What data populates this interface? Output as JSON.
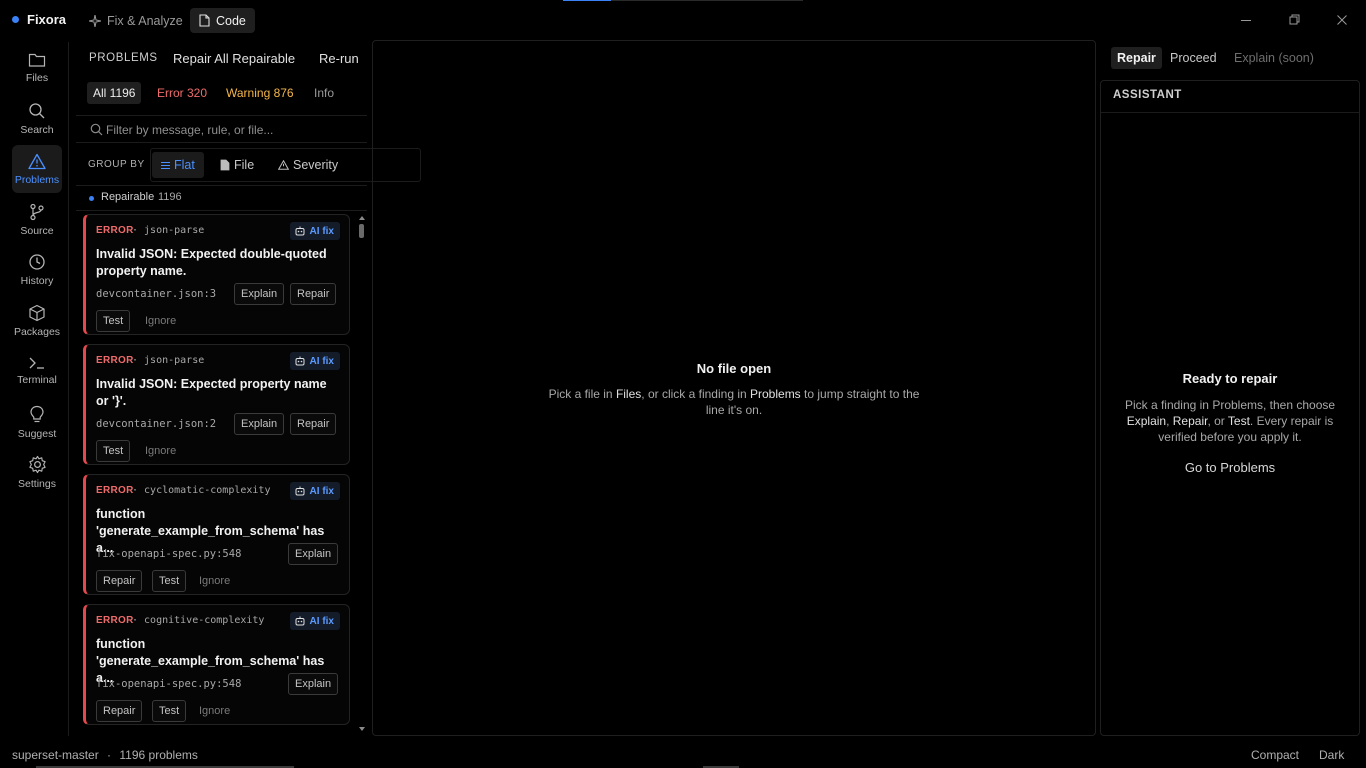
{
  "app": {
    "name": "Fixora"
  },
  "top_tabs": [
    {
      "label": "Fix & Analyze",
      "icon": "sparkle-icon"
    },
    {
      "label": "Code",
      "icon": "file-icon"
    }
  ],
  "top_progress": {
    "fraction": 0.2
  },
  "rail": [
    {
      "label": "Files",
      "icon": "folder-icon"
    },
    {
      "label": "Search",
      "icon": "search-icon"
    },
    {
      "label": "Problems",
      "icon": "warning-triangle-icon",
      "active": true
    },
    {
      "label": "Source",
      "icon": "git-branch-icon"
    },
    {
      "label": "History",
      "icon": "clock-icon"
    },
    {
      "label": "Packages",
      "icon": "package-icon"
    },
    {
      "label": "Terminal",
      "icon": "terminal-icon"
    },
    {
      "label": "Suggest",
      "icon": "lightbulb-icon"
    },
    {
      "label": "Settings",
      "icon": "gear-icon"
    }
  ],
  "problems": {
    "title": "PROBLEMS",
    "repair_all": "Repair All Repairable",
    "rerun": "Re-run",
    "filters": {
      "all": "All 1196",
      "error": "Error 320",
      "warning": "Warning 876",
      "info": "Info"
    },
    "search_placeholder": "Filter by message, rule, or file...",
    "group_by": {
      "label": "GROUP BY",
      "flat": "Flat",
      "file": "File",
      "severity": "Severity"
    },
    "repairable": {
      "label": "Repairable",
      "count": "1196"
    },
    "cards": [
      {
        "severity": "ERROR",
        "rule": "· json-parse",
        "badge": "AI fix",
        "title": "Invalid JSON: Expected double-quoted property name.",
        "file": "devcontainer.json:3",
        "explain": "Explain",
        "repair": "Repair",
        "test": "Test",
        "ignore": "Ignore"
      },
      {
        "severity": "ERROR",
        "rule": "· json-parse",
        "badge": "AI fix",
        "title": "Invalid JSON: Expected property name or '}'.",
        "file": "devcontainer.json:2",
        "explain": "Explain",
        "repair": "Repair",
        "test": "Test",
        "ignore": "Ignore"
      },
      {
        "severity": "ERROR",
        "rule": "· cyclomatic-complexity",
        "badge": "AI fix",
        "title_line1": "function",
        "title_line2": "'generate_example_from_schema' has a...",
        "file": "fix-openapi-spec.py:548",
        "explain": "Explain",
        "repair": "Repair",
        "test": "Test",
        "ignore": "Ignore"
      },
      {
        "severity": "ERROR",
        "rule": "· cognitive-complexity",
        "badge": "AI fix",
        "title_line1": "function",
        "title_line2": "'generate_example_from_schema' has a...",
        "file": "fix-openapi-spec.py:548",
        "explain": "Explain",
        "repair": "Repair",
        "test": "Test",
        "ignore": "Ignore"
      }
    ]
  },
  "editor": {
    "empty_title": "No file open",
    "desc_1": "Pick a file in ",
    "desc_files": "Files",
    "desc_2": ", or click a finding in ",
    "desc_problems": "Problems",
    "desc_3": " to jump straight to the line it's on."
  },
  "assistant": {
    "tabs": {
      "repair": "Repair",
      "proceed": "Proceed",
      "explain": "Explain (soon)"
    },
    "header": "ASSISTANT",
    "title": "Ready to repair",
    "desc_1": "Pick a finding in Problems, then choose ",
    "desc_explain": "Explain",
    "desc_2": ", ",
    "desc_repair": "Repair",
    "desc_3": ", or ",
    "desc_test": "Test",
    "desc_4": ". Every repair is verified before you apply it.",
    "link": "Go to Problems"
  },
  "status": {
    "project": "superset-master",
    "sep": "·",
    "problems": "1196 problems",
    "compact": "Compact",
    "theme": "Dark"
  },
  "colors": {
    "accent": "#3b82f6",
    "error": "#e5484d",
    "warning": "#f5b649",
    "background": "#000000"
  }
}
